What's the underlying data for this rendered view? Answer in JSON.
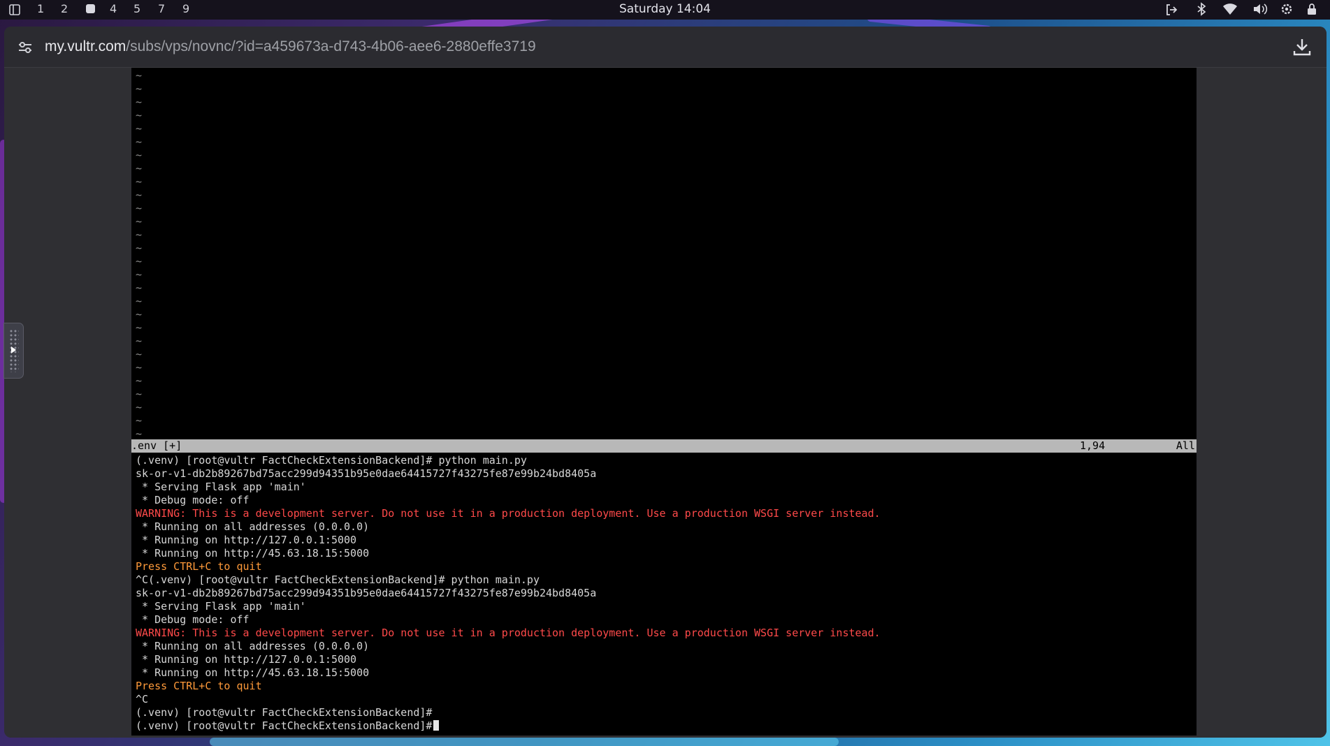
{
  "topbar": {
    "workspaces": [
      "1",
      "2",
      "4",
      "5",
      "7",
      "9"
    ],
    "active_workspace_label": "3",
    "clock": "Saturday 14:04",
    "tray_icons": [
      "logout-icon",
      "bluetooth-icon",
      "wifi-icon",
      "volume-icon",
      "settings-icon",
      "lock-icon"
    ]
  },
  "browser": {
    "url_host": "my.vultr.com",
    "url_path": "/subs/vps/novnc/?id=a459673a-d743-4b06-aee6-2880effe3719"
  },
  "terminal": {
    "tilde": "~",
    "status_file": ".env [+]",
    "status_pos": "1,94",
    "status_all": "All",
    "lines": [
      "(.venv) [root@vultr FactCheckExtensionBackend]# python main.py",
      "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",
      " * Serving Flask app 'main'",
      " * Debug mode: off",
      "WARNING: This is a development server. Do not use it in a production deployment. Use a production WSGI server instead.",
      " * Running on all addresses (0.0.0.0)",
      " * Running on http://127.0.0.1:5000",
      " * Running on http://45.63.18.15:5000",
      "Press CTRL+C to quit",
      "^C(.venv) [root@vultr FactCheckExtensionBackend]# python main.py",
      "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",
      " * Serving Flask app 'main'",
      " * Debug mode: off",
      "WARNING: This is a development server. Do not use it in a production deployment. Use a production WSGI server instead.",
      " * Running on all addresses (0.0.0.0)",
      " * Running on http://127.0.0.1:5000",
      " * Running on http://45.63.18.15:5000",
      "Press CTRL+C to quit",
      "^C",
      "(.venv) [root@vultr FactCheckExtensionBackend]#",
      "(.venv) [root@vultr FactCheckExtensionBackend]#"
    ],
    "line_colors": [
      "",
      "",
      "",
      "",
      "red",
      "",
      "",
      "",
      "orange",
      "",
      "",
      "",
      "",
      "red",
      "",
      "",
      "",
      "orange",
      "",
      "",
      ""
    ]
  }
}
